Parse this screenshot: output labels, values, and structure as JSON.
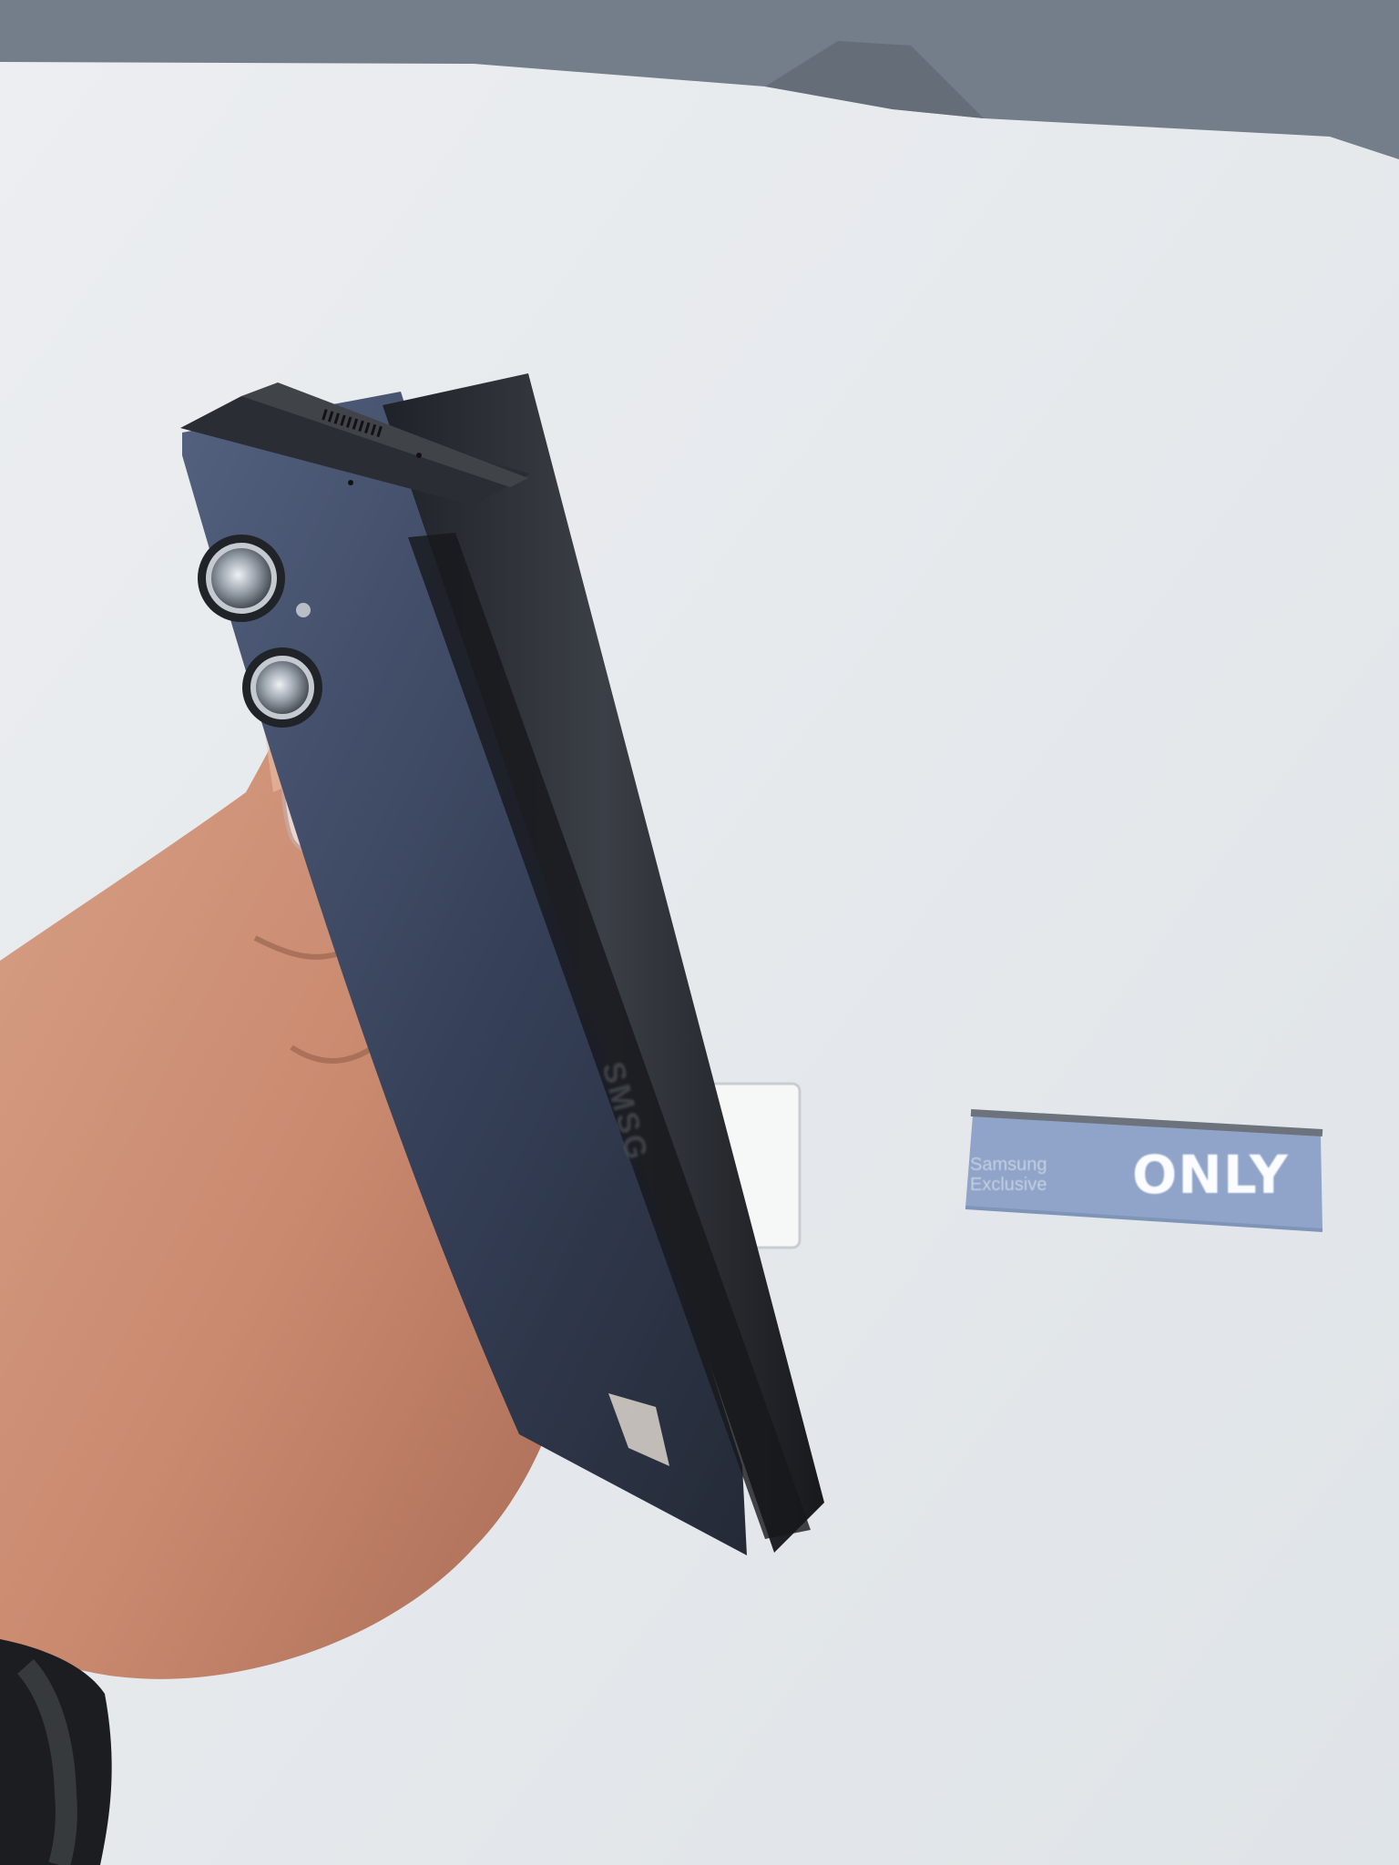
{
  "scene": {
    "subject": "Foldable phone held in hand",
    "background_color": "#e6e9ec",
    "phone_color": "#353f57",
    "sign_color": "#8fa4c8"
  },
  "sign": {
    "brand_lines": [
      "Samsung",
      "Exclusive"
    ],
    "label": "ONLY"
  },
  "phone": {
    "edge_text": "SMSG"
  }
}
